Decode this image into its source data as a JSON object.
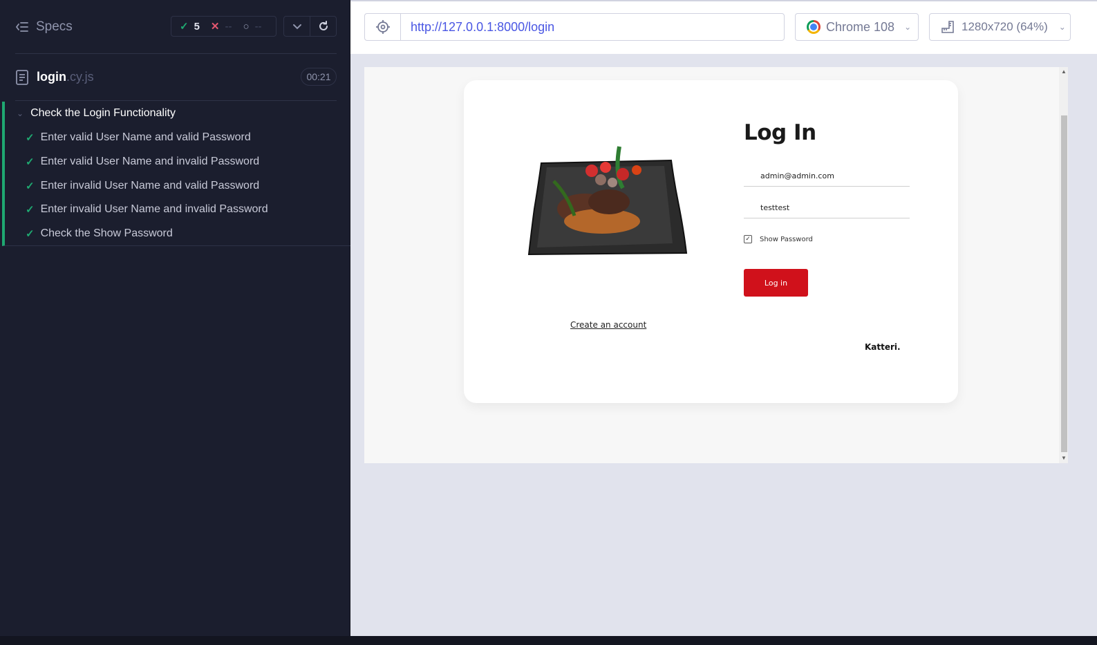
{
  "reporter": {
    "specs_label": "Specs",
    "stats": {
      "passed": "5",
      "failed": "--",
      "pending": "--"
    },
    "spec": {
      "name": "login",
      "ext": ".cy.js",
      "duration": "00:21"
    },
    "suite": {
      "title": "Check the Login Functionality",
      "tests": [
        {
          "title": "Enter valid User Name and valid Password",
          "state": "passed"
        },
        {
          "title": "Enter valid User Name and invalid Password",
          "state": "passed"
        },
        {
          "title": "Enter invalid User Name and valid Password",
          "state": "passed"
        },
        {
          "title": "Enter invalid User Name and invalid Password",
          "state": "passed"
        },
        {
          "title": "Check the Show Password",
          "state": "passed"
        }
      ]
    },
    "colors": {
      "passed": "#1fa971",
      "failed": "#e45770",
      "background": "#1b1e2e"
    }
  },
  "toolbar": {
    "url": "http://127.0.0.1:8000/login",
    "browser": "Chrome 108",
    "viewport": "1280x720 (64%)"
  },
  "app": {
    "title": "Log In",
    "email_value": "admin@admin.com",
    "password_value": "testtest",
    "show_password_label": "Show Password",
    "show_password_checked": true,
    "login_button": "Log in",
    "create_account_link": "Create an account",
    "brand": "Katteri.",
    "colors": {
      "login_button": "#d0111b"
    }
  }
}
